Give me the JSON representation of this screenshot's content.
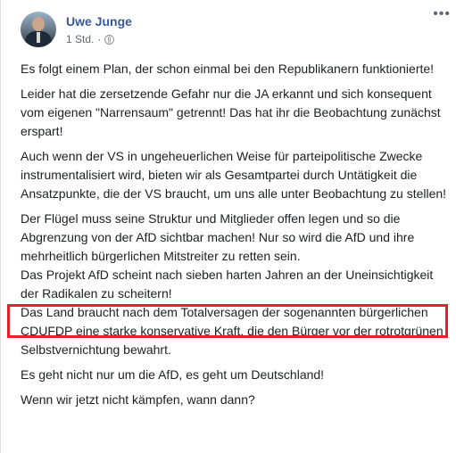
{
  "post": {
    "author": "Uwe Junge",
    "timestamp": "1 Std.",
    "separator": "·",
    "privacy_icon": "globe-icon",
    "more_label": "•••",
    "paragraphs": [
      "Es folgt einem Plan, der schon einmal bei den Republikanern funktionierte!",
      "Leider hat die zersetzende Gefahr nur die JA erkannt und sich konsequent vom eigenen \"Narrensaum\" getrennt! Das hat ihr die Beobachtung zunächst erspart!",
      "Auch wenn der VS in ungeheuerlichen Weise für parteipolitische Zwecke instrumentalisiert wird, bieten wir als Gesamtpartei durch Untätigkeit die Ansatzpunkte, die der VS braucht, um uns alle unter Beobachtung zu stellen!",
      "Der Flügel muss seine Struktur und Mitglieder offen legen und so die Abgrenzung von der AfD sichtbar machen! Nur so wird die AfD und ihre mehrheitlich bürgerlichen Mitstreiter zu retten sein."
    ],
    "highlighted": "Das Projekt AfD scheint nach sieben harten Jahren an der Uneinsichtigkeit der Radikalen zu scheitern!",
    "paragraphs_after": [
      "Das Land braucht nach dem Totalversagen der sogenannten bürgerlichen CDUFDP eine starke konservative Kraft, die den Bürger vor der rotrotgrünen Selbstvernichtung bewahrt.",
      "Es geht nicht nur um die AfD, es geht um Deutschland!",
      "Wenn wir jetzt nicht kämpfen, wann dann?"
    ]
  },
  "colors": {
    "author": "#385898",
    "meta": "#616770",
    "text": "#1c1e21",
    "highlight_border": "#e8202a"
  }
}
